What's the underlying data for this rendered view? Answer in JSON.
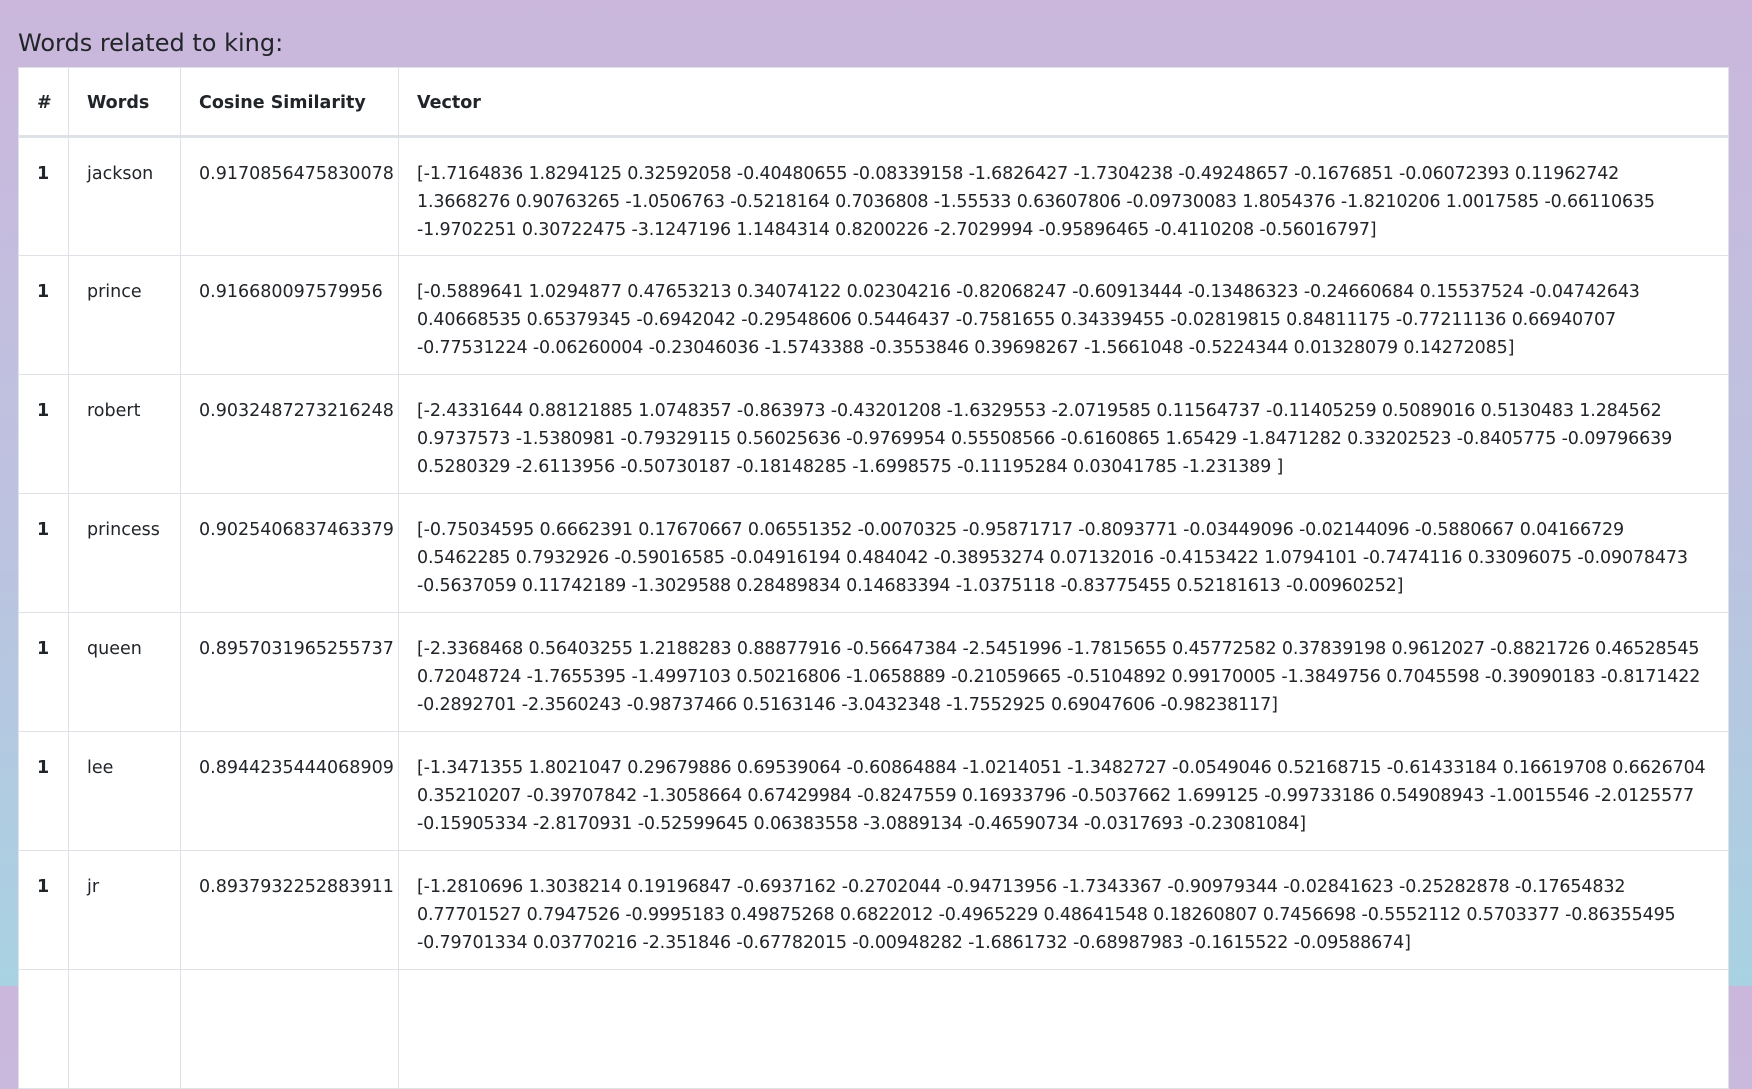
{
  "heading": "Words related to king:",
  "table": {
    "columns": [
      "#",
      "Words",
      "Cosine Similarity",
      "Vector"
    ],
    "rows": [
      {
        "num": "1",
        "word": "jackson",
        "similarity": "0.9170856475830078",
        "vector": "[-1.7164836  1.8294125  0.32592058 -0.40480655 -0.08339158 -1.6826427 -1.7304238  -0.49248657 -0.1676851  -0.06072393  0.11962742  1.3668276 0.90763265 -1.0506763  -0.5218164   0.7036808  -1.55533     0.63607806 -0.09730083  1.8054376  -1.8210206   1.0017585  -0.66110635 -1.9702251 0.30722475 -3.1247196   1.1484314   0.8200226  -2.7029994  -0.95896465 -0.4110208  -0.56016797]"
      },
      {
        "num": "1",
        "word": "prince",
        "similarity": "0.916680097579956",
        "vector": "[-0.5889641   1.0294877   0.47653213  0.34074122  0.02304216 -0.82068247 -0.60913444 -0.13486323 -0.24660684  0.15537524 -0.04742643  0.40668535 0.65379345 -0.6942042  -0.29548606  0.5446437  -0.7581655   0.34339455 -0.02819815  0.84811175 -0.77211136  0.66940707 -0.77531224 -0.06260004 -0.23046036 -1.5743388  -0.3553846   0.39698267 -1.5661048  -0.5224344 0.01328079  0.14272085]"
      },
      {
        "num": "1",
        "word": "robert",
        "similarity": "0.9032487273216248",
        "vector": "[-2.4331644   0.88121885  1.0748357  -0.863973   -0.43201208 -1.6329553 -2.0719585   0.11564737 -0.11405259  0.5089016   0.5130483   1.284562 0.9737573  -1.5380981  -0.79329115  0.56025636 -0.9769954   0.55508566 -0.6160865   1.65429    -1.8471282   0.33202523 -0.8405775  -0.09796639 0.5280329  -2.6113956  -0.50730187 -0.18148285 -1.6998575  -0.11195284 0.03041785 -1.231389  ]"
      },
      {
        "num": "1",
        "word": "princess",
        "similarity": "0.9025406837463379",
        "vector": "[-0.75034595  0.6662391   0.17670667  0.06551352 -0.0070325  -0.95871717 -0.8093771  -0.03449096 -0.02144096 -0.5880667   0.04166729  0.5462285 0.7932926  -0.59016585 -0.04916194  0.484042   -0.38953274  0.07132016 -0.4153422   1.0794101  -0.7474116   0.33096075 -0.09078473 -0.5637059 0.11742189 -1.3029588   0.28489834  0.14683394 -1.0375118  -0.83775455 0.52181613 -0.00960252]"
      },
      {
        "num": "1",
        "word": "queen",
        "similarity": "0.8957031965255737",
        "vector": "[-2.3368468   0.56403255  1.2188283   0.88877916 -0.56647384 -2.5451996 -1.7815655   0.45772582  0.37839198  0.9612027  -0.8821726   0.46528545 0.72048724 -1.7655395  -1.4997103   0.50216806 -1.0658889  -0.21059665 -0.5104892   0.99170005 -1.3849756   0.7045598  -0.39090183 -0.8171422 -0.2892701  -2.3560243  -0.98737466  0.5163146  -3.0432348  -1.7552925 0.69047606 -0.98238117]"
      },
      {
        "num": "1",
        "word": "lee",
        "similarity": "0.8944235444068909",
        "vector": "[-1.3471355   1.8021047   0.29679886  0.69539064 -0.60864884 -1.0214051 -1.3482727  -0.0549046   0.52168715 -0.61433184  0.16619708  0.6626704 0.35210207 -0.39707842 -1.3058664   0.67429984 -0.8247559   0.16933796 -0.5037662   1.699125   -0.99733186  0.54908943 -1.0015546  -2.0125577 -0.15905334 -2.8170931  -0.52599645  0.06383558 -3.0889134  -0.46590734 -0.0317693  -0.23081084]"
      },
      {
        "num": "1",
        "word": "jr",
        "similarity": "0.8937932252883911",
        "vector": "[-1.2810696   1.3038214   0.19196847 -0.6937162  -0.2702044  -0.94713956 -1.7343367  -0.90979344 -0.02841623 -0.25282878 -0.17654832  0.77701527 0.7947526  -0.9995183   0.49875268  0.6822012  -0.4965229   0.48641548 0.18260807  0.7456698  -0.5552112   0.5703377  -0.86355495 -0.79701334 0.03770216 -2.351846   -0.67782015 -0.00948282 -1.6861732  -0.68987983 -0.1615522  -0.09588674]"
      },
      {
        "num": "",
        "word": "",
        "similarity": "",
        "vector": ""
      }
    ]
  }
}
